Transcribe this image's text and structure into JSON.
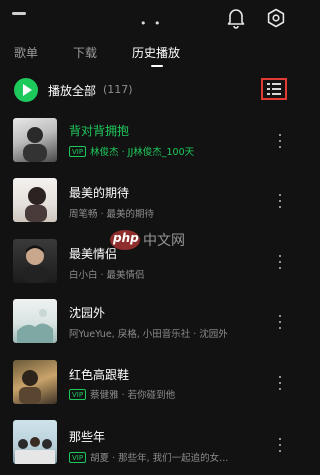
{
  "tabs": [
    {
      "label": "歌单",
      "active": false
    },
    {
      "label": "下载",
      "active": false
    },
    {
      "label": "历史播放",
      "active": true
    }
  ],
  "play_all": {
    "label": "播放全部",
    "count": "(117)"
  },
  "songs": [
    {
      "title": "背对背拥抱",
      "vip": true,
      "subtitle": "林俊杰 · JJ林俊杰_100天",
      "playing": true
    },
    {
      "title": "最美的期待",
      "vip": false,
      "subtitle": "周笔畅 · 最美的期待",
      "playing": false
    },
    {
      "title": "最美情侣",
      "vip": false,
      "subtitle": "白小白 · 最美情侣",
      "playing": false
    },
    {
      "title": "沈园外",
      "vip": false,
      "subtitle": "阿YueYue, 戾格, 小田音乐社 · 沈园外",
      "playing": false
    },
    {
      "title": "红色高跟鞋",
      "vip": true,
      "subtitle": "蔡健雅 · 若你碰到他",
      "playing": false
    },
    {
      "title": "那些年",
      "vip": true,
      "subtitle": "胡夏 · 那些年, 我们一起追的女...",
      "playing": false
    }
  ],
  "vip_label": "VIP",
  "watermark": {
    "brand": "php",
    "text": "中文网"
  },
  "colors": {
    "accent": "#1ec95c",
    "highlight_box": "#e23b32",
    "background": "#121212"
  },
  "icons": [
    "back-icon",
    "bell-icon",
    "settings-icon",
    "play-icon",
    "list-manage-icon",
    "more-icon"
  ]
}
